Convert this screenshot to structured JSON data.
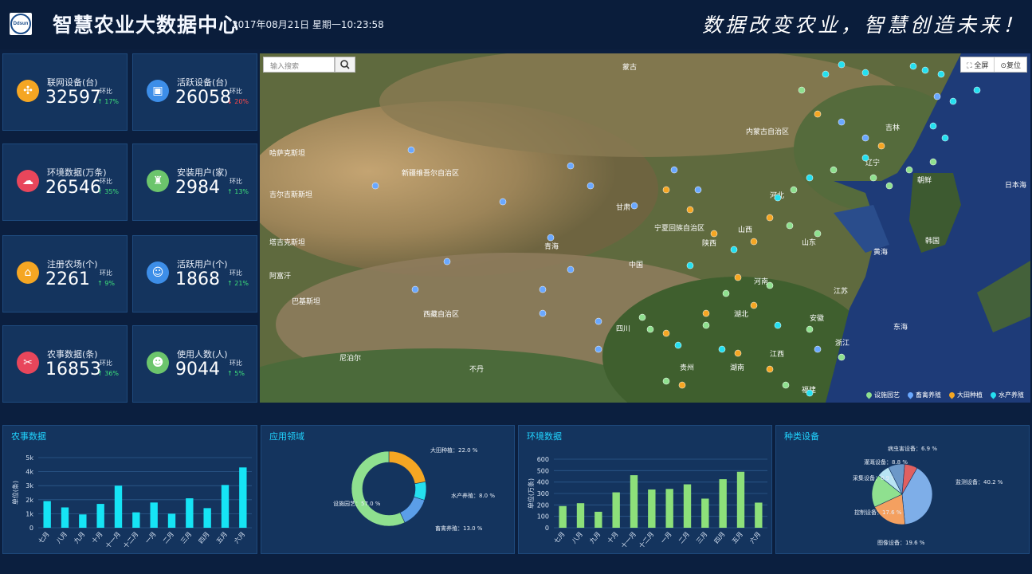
{
  "header": {
    "logo_text": "Ddsun",
    "title": "智慧农业大数据中心",
    "datetime": "2017年08月21日 星期一10:23:58",
    "slogan": "数据改变农业，智慧创造未来！"
  },
  "stats": [
    {
      "label": "联网设备(台)",
      "value": "32597",
      "hb": "环比",
      "pct": "↑ 17%",
      "trend": "up",
      "color": "#f5a623",
      "icon": "network-icon"
    },
    {
      "label": "活跃设备(台)",
      "value": "26058",
      "hb": "环比",
      "pct": "↓ 20%",
      "trend": "down",
      "color": "#3d8ee8",
      "icon": "device-icon"
    },
    {
      "label": "环境数据(万条)",
      "value": "26546",
      "hb": "环比",
      "pct": "↑ 35%",
      "trend": "up",
      "color": "#e8465b",
      "icon": "cloud-icon"
    },
    {
      "label": "安装用户(家)",
      "value": "2984",
      "hb": "环比",
      "pct": "↑ 13%",
      "trend": "up",
      "color": "#6cc56c",
      "icon": "user-install-icon"
    },
    {
      "label": "注册农场(个)",
      "value": "2261",
      "hb": "环比",
      "pct": "↑ 9%",
      "trend": "up",
      "color": "#f5a623",
      "icon": "home-icon"
    },
    {
      "label": "活跃用户(个)",
      "value": "1868",
      "hb": "环比",
      "pct": "↑ 21%",
      "trend": "up",
      "color": "#3d8ee8",
      "icon": "active-user-icon"
    },
    {
      "label": "农事数据(条)",
      "value": "16853",
      "hb": "环比",
      "pct": "↑ 36%",
      "trend": "up",
      "color": "#e8465b",
      "icon": "tools-icon"
    },
    {
      "label": "使用人数(人)",
      "value": "9044",
      "hb": "环比",
      "pct": "↑ 5%",
      "trend": "up",
      "color": "#6cc56c",
      "icon": "people-icon"
    }
  ],
  "map": {
    "search_placeholder": "输入搜索",
    "fullscreen_label": "全屏",
    "reset_label": "复位",
    "labels": [
      "蒙古",
      "中国",
      "朝鲜",
      "韩国",
      "日本海",
      "黄海",
      "东海",
      "新疆维吾尔自治区",
      "西藏自治区",
      "青海",
      "甘肃",
      "内蒙古自治区",
      "河北",
      "山西",
      "陕西",
      "河南",
      "湖北",
      "四川",
      "贵州",
      "湖南",
      "江西",
      "安徽",
      "浙江",
      "江苏",
      "山东",
      "吉林",
      "辽宁",
      "宁夏回族自治区",
      "福建",
      "不丹",
      "尼泊尔",
      "哈萨克斯坦",
      "吉尔吉斯斯坦",
      "塔吉克斯坦",
      "阿富汗",
      "巴基斯坦"
    ],
    "legend": [
      {
        "label": "设施园艺",
        "color": "#8fe08f"
      },
      {
        "label": "畜禽养殖",
        "color": "#6aa8ff"
      },
      {
        "label": "大田种植",
        "color": "#f5a623"
      },
      {
        "label": "水产养殖",
        "color": "#25e0f0"
      }
    ]
  },
  "panels": {
    "farm": {
      "title": "农事数据"
    },
    "app": {
      "title": "应用领域"
    },
    "env": {
      "title": "环境数据"
    },
    "device": {
      "title": "种类设备"
    }
  },
  "chart_data": [
    {
      "type": "bar",
      "title": "农事数据",
      "ylabel": "单位(条)",
      "categories": [
        "七月",
        "八月",
        "九月",
        "十月",
        "十一月",
        "十二月",
        "一月",
        "二月",
        "三月",
        "四月",
        "五月",
        "六月"
      ],
      "values": [
        1900,
        1450,
        950,
        1700,
        3000,
        1100,
        1800,
        1000,
        2100,
        1400,
        3050,
        4300
      ],
      "ylim": [
        0,
        5000
      ],
      "yticks": [
        "0",
        "1k",
        "2k",
        "3k",
        "4k",
        "5k"
      ],
      "color": "#16e4f5"
    },
    {
      "type": "pie",
      "title": "应用领域",
      "categories": [
        "大田种植",
        "水产养殖",
        "畜禽养殖",
        "设施园艺"
      ],
      "values": [
        22.0,
        8.0,
        13.0,
        57.0
      ],
      "labels": [
        "大田种植：22.0 %",
        "水产养殖：8.0 %",
        "畜禽养殖：13.0 %",
        "设施园艺：57.0 %"
      ],
      "colors": [
        "#f5a623",
        "#25e0f0",
        "#5b9ee8",
        "#8fe08f"
      ]
    },
    {
      "type": "bar",
      "title": "环境数据",
      "ylabel": "单位(万条)",
      "categories": [
        "七月",
        "八月",
        "九月",
        "十月",
        "十一月",
        "十二月",
        "一月",
        "二月",
        "三月",
        "四月",
        "五月",
        "六月"
      ],
      "values": [
        190,
        215,
        140,
        310,
        460,
        335,
        340,
        380,
        255,
        425,
        490,
        220
      ],
      "ylim": [
        0,
        600
      ],
      "yticks": [
        "0",
        "100",
        "200",
        "300",
        "400",
        "500",
        "600"
      ],
      "color": "#8de07a"
    },
    {
      "type": "pie",
      "title": "种类设备",
      "categories": [
        "监测设备",
        "图像设备",
        "控制设备",
        "采集设备",
        "灌溉设备",
        "病虫害设备"
      ],
      "values": [
        40.2,
        19.6,
        17.6,
        6.9,
        8.8,
        6.9
      ],
      "labels": [
        "监测设备：40.2 %",
        "图像设备：19.6 %",
        "控制设备：17.6 %",
        "采集设备：6.9 %",
        "灌溉设备：8.8 %",
        "病虫害设备：6.9 %"
      ],
      "colors": [
        "#7eaee8",
        "#f4a060",
        "#8fe08f",
        "#b8e4f4",
        "#6c98c8",
        "#e06060"
      ]
    }
  ]
}
